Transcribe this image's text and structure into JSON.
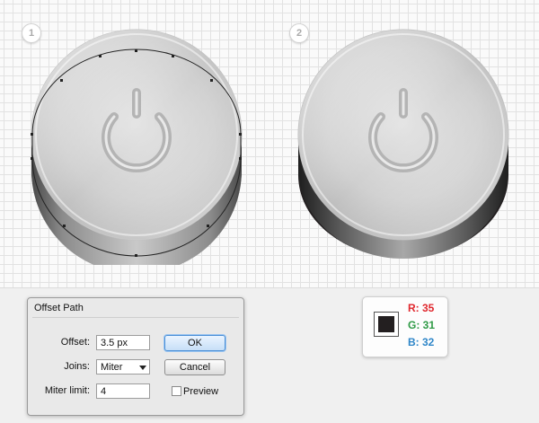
{
  "steps": [
    {
      "number": "1"
    },
    {
      "number": "2"
    }
  ],
  "icons": {
    "power": "power-icon",
    "dropdown": "chevron-down-icon"
  },
  "dialog": {
    "title": "Offset Path",
    "offset_label": "Offset:",
    "offset_value": "3.5 px",
    "joins_label": "Joins:",
    "joins_value": "Miter",
    "miter_label": "Miter limit:",
    "miter_value": "4",
    "ok_label": "OK",
    "cancel_label": "Cancel",
    "preview_label": "Preview",
    "preview_checked": false
  },
  "color_card": {
    "swatch_color": "#231f20",
    "r_label": "R: 35",
    "g_label": "G: 31",
    "b_label": "B: 32",
    "r_color": "#e0282e",
    "g_color": "#2e9a45",
    "b_color": "#2f86c8"
  }
}
